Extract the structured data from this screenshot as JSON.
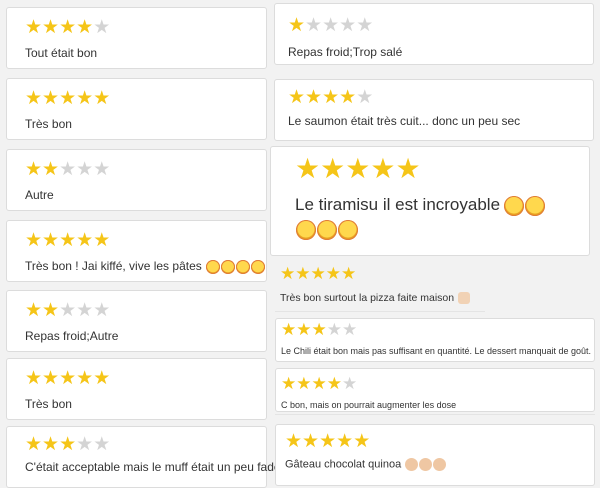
{
  "colors": {
    "star_on": "#f5c518",
    "star_off": "#d4d4d4",
    "border": "#dcdcdc"
  },
  "left_reviews": [
    {
      "rating": 4,
      "max": 5,
      "text": "Tout était bon",
      "emoji": []
    },
    {
      "rating": 5,
      "max": 5,
      "text": "Très bon",
      "emoji": []
    },
    {
      "rating": 2,
      "max": 5,
      "text": "Autre",
      "emoji": []
    },
    {
      "rating": 5,
      "max": 5,
      "text": "Très bon ! Jai kiffé, vive les pâtes",
      "emoji": [
        "star-struck-icon",
        "star-struck-icon",
        "star-struck-icon",
        "star-struck-icon"
      ]
    },
    {
      "rating": 2,
      "max": 5,
      "text": "Repas froid;Autre",
      "emoji": []
    },
    {
      "rating": 5,
      "max": 5,
      "text": "Très bon",
      "emoji": []
    },
    {
      "rating": 3,
      "max": 5,
      "text": "C'était acceptable mais le muff était un peu fade",
      "emoji": []
    }
  ],
  "right_reviews": [
    {
      "rating": 1,
      "max": 5,
      "text": "Repas froid;Trop salé",
      "emoji": []
    },
    {
      "rating": 4,
      "max": 5,
      "text": "Le saumon était très cuit... donc un peu sec",
      "emoji": []
    },
    {
      "rating": 5,
      "max": 5,
      "text": "Le tiramisu il est incroyable",
      "emoji": [
        "star-struck-icon",
        "star-struck-icon",
        "star-struck-icon",
        "star-struck-icon",
        "star-struck-icon"
      ]
    },
    {
      "rating": 5,
      "max": 5,
      "text": "Très bon surtout la pizza faite maison",
      "emoji": [
        "thumbs-up-icon"
      ]
    },
    {
      "rating": 3,
      "max": 5,
      "text": "Le Chili était bon mais pas suffisant en quantité. Le dessert manquait de goût.",
      "emoji": []
    },
    {
      "rating": 4,
      "max": 5,
      "text": "C bon, mais on pourrait augmenter les dose",
      "emoji": []
    },
    {
      "rating": 5,
      "max": 5,
      "text": "Gâteau chocolat quinoa",
      "emoji": [
        "ok-hand-icon",
        "ok-hand-icon",
        "ok-hand-icon"
      ]
    }
  ]
}
